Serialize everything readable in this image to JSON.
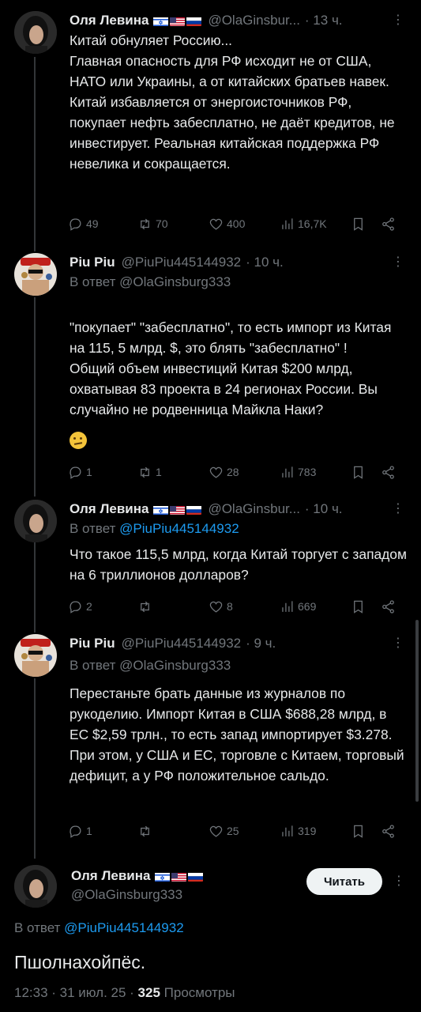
{
  "tweets": [
    {
      "author": "Оля Левина",
      "handle": "@OlaGinsbur...",
      "time": "· 13 ч.",
      "reply_label": "",
      "reply_to": "",
      "text": "Китай обнуляет Россию...\nГлавная опасность для РФ исходит не от США, НАТО или Украины, а от китайских братьев навек. Китай избавляется от энергоисточников РФ, покупает нефть забесплатно, не даёт кредитов, не инвестирует. Реальная китайская поддержка РФ невелика и сокращается.",
      "replies": "49",
      "retweets": "70",
      "likes": "400",
      "views": "16,7K"
    },
    {
      "author": "Piu Piu",
      "handle": "@PiuPiu445144932",
      "time": "· 10 ч.",
      "reply_label": "В ответ ",
      "reply_to": "@OlaGinsburg333",
      "text": "\"покупает\" \"забесплатно\", то есть импорт из Китая на 115, 5 млрд. $, это блять \"забесплатно\" !\nОбщий объем инвестиций Китая  $200 млрд, охватывая 83 проекта в 24 регионах России. Вы случайно не родвенница Майкла Наки?",
      "replies": "1",
      "retweets": "1",
      "likes": "28",
      "views": "783"
    },
    {
      "author": "Оля Левина",
      "handle": "@OlaGinsbur...",
      "time": "· 10 ч.",
      "reply_label": "В ответ ",
      "reply_to": "@PiuPiu445144932",
      "text": "Что такое 115,5 млрд, когда Китай торгует с западом на 6 триллионов долларов?",
      "replies": "2",
      "retweets": "",
      "likes": "8",
      "views": "669"
    },
    {
      "author": "Piu Piu",
      "handle": "@PiuPiu445144932",
      "time": "· 9 ч.",
      "reply_label": "В ответ ",
      "reply_to": "@OlaGinsburg333",
      "text": "Перестаньте брать данные из журналов по рукоделию. Импорт Китая в США $688,28 млрд, в ЕС $2,59 трлн., то есть запад импортирует $3.278. При этом, у США и ЕС, торговле с Китаем, торговый дефицит, а у РФ положительное сальдо.",
      "replies": "1",
      "retweets": "",
      "likes": "25",
      "views": "319"
    }
  ],
  "main": {
    "author": "Оля Левина",
    "handle": "@OlaGinsburg333",
    "follow_label": "Читать",
    "reply_label": "В ответ ",
    "reply_to": "@PiuPiu445144932",
    "text": "Пшолнахойпёс.",
    "timestamp": "12:33 · 31 июл. 25 · ",
    "views_count": "325",
    "views_label": " Просмотры"
  },
  "icons": [
    "reply-icon",
    "retweet-icon",
    "like-icon",
    "views-icon",
    "bookmark-icon",
    "share-icon",
    "more-icon",
    "thinking-face-emoji"
  ],
  "colors": {
    "accent": "#1d9bf0",
    "muted": "#71767b",
    "text": "#e7e9ea",
    "background": "#000000"
  }
}
